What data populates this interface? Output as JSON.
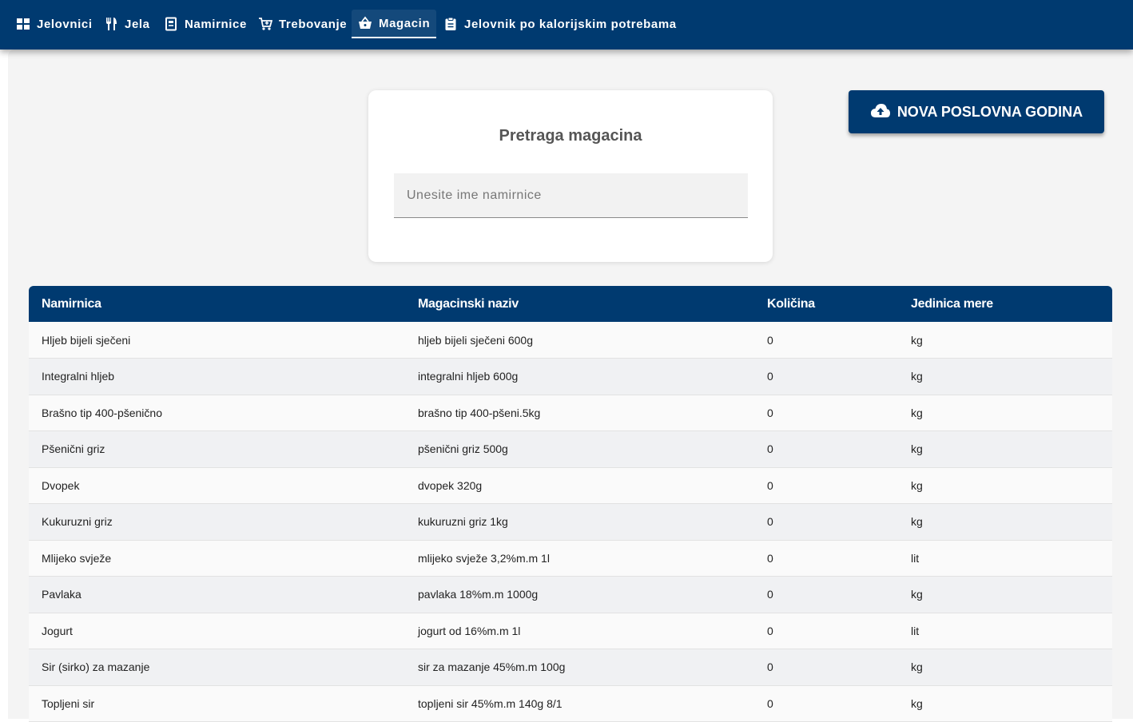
{
  "nav": {
    "items": [
      {
        "label": "Jelovnici",
        "icon": "grid-icon"
      },
      {
        "label": "Jela",
        "icon": "fork-knife-icon"
      },
      {
        "label": "Namirnice",
        "icon": "document-icon"
      },
      {
        "label": "Trebovanje",
        "icon": "cart-icon"
      },
      {
        "label": "Magacin",
        "icon": "basket-icon",
        "active": true
      },
      {
        "label": "Jelovnik po kalorijskim potrebama",
        "icon": "clipboard-icon"
      }
    ]
  },
  "search": {
    "title": "Pretraga magacina",
    "placeholder": "Unesite ime namirnice",
    "value": ""
  },
  "actions": {
    "new_year_label": "NOVA POSLOVNA GODINA",
    "new_year_icon": "cloud-upload-icon"
  },
  "table": {
    "headers": [
      "Namirnica",
      "Magacinski naziv",
      "Količina",
      "Jedinica mere"
    ],
    "rows": [
      [
        "Hljeb bijeli sječeni",
        "hljeb bijeli sječeni 600g",
        "0",
        "kg"
      ],
      [
        "Integralni hljeb",
        "integralni hljeb 600g",
        "0",
        "kg"
      ],
      [
        "Brašno tip 400-pšenično",
        "brašno tip 400-pšeni.5kg",
        "0",
        "kg"
      ],
      [
        "Pšenični griz",
        "pšenični griz 500g",
        "0",
        "kg"
      ],
      [
        "Dvopek",
        "dvopek 320g",
        "0",
        "kg"
      ],
      [
        "Kukuruzni griz",
        "kukuruzni griz 1kg",
        "0",
        "kg"
      ],
      [
        "Mlijeko svježe",
        "mlijeko svježe 3,2%m.m 1l",
        "0",
        "lit"
      ],
      [
        "Pavlaka",
        "pavlaka 18%m.m 1000g",
        "0",
        "kg"
      ],
      [
        "Jogurt",
        "jogurt od 16%m.m 1l",
        "0",
        "lit"
      ],
      [
        "Sir (sirko) za mazanje",
        "sir za mazanje 45%m.m 100g",
        "0",
        "kg"
      ],
      [
        "Topljeni sir",
        "topljeni sir 45%m.m 140g 8/1",
        "0",
        "kg"
      ]
    ]
  },
  "colors": {
    "primary": "#003a70",
    "background": "#f4f4f4",
    "row_alt": "#f0f1f3"
  }
}
